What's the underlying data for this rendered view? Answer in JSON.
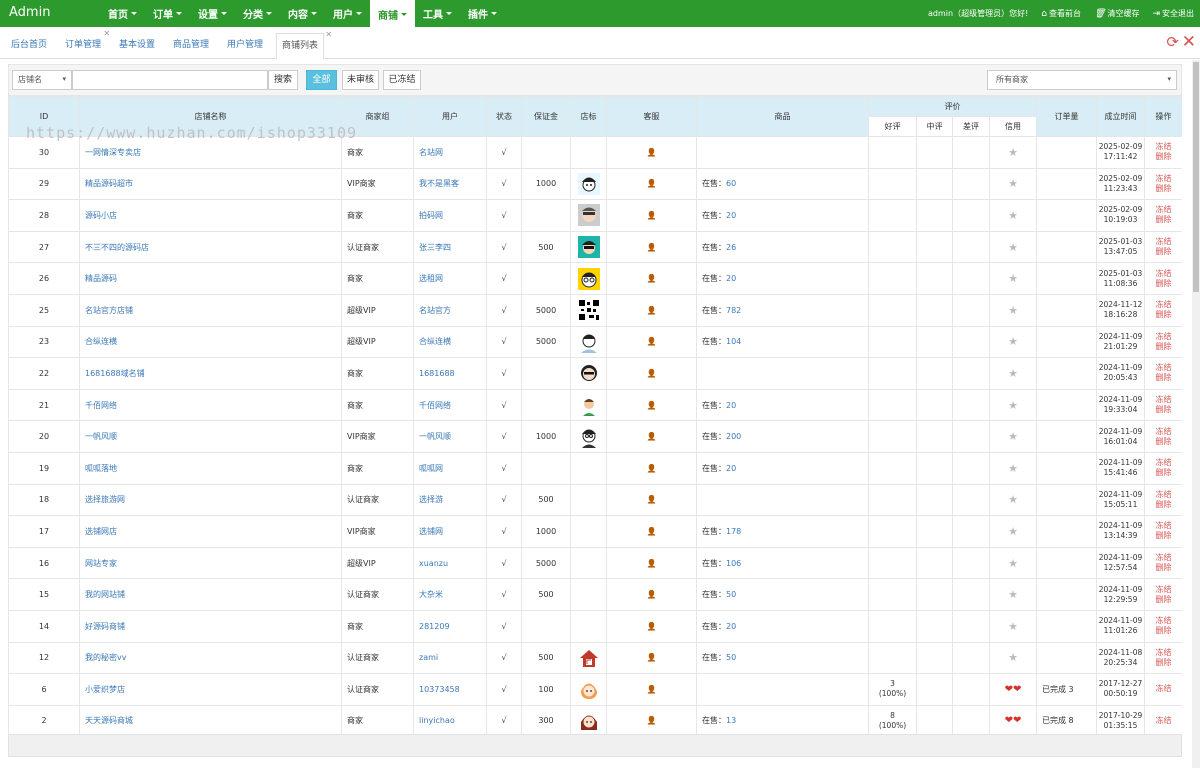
{
  "topbar": {
    "brand": "Admin",
    "nav": [
      {
        "label": "首页"
      },
      {
        "label": "订单"
      },
      {
        "label": "设置"
      },
      {
        "label": "分类"
      },
      {
        "label": "内容"
      },
      {
        "label": "用户"
      },
      {
        "label": "商铺",
        "active": true
      },
      {
        "label": "工具"
      },
      {
        "label": "插件"
      }
    ],
    "user": "admin（超级管理员）您好!",
    "view_front": "查看前台",
    "clear_cache": "清空缓存",
    "logout": "安全退出"
  },
  "tabs": [
    {
      "label": "后台首页",
      "closable": false
    },
    {
      "label": "订单管理",
      "closable": true
    },
    {
      "label": "基本设置",
      "closable": false
    },
    {
      "label": "商品管理",
      "closable": false
    },
    {
      "label": "用户管理",
      "closable": false
    },
    {
      "label": "商铺列表",
      "closable": true,
      "active": true
    }
  ],
  "toolbar": {
    "field_select": "店铺名",
    "search_placeholder": "",
    "search_button": "搜索",
    "filters": {
      "all": "全部",
      "unreviewed": "未审核",
      "frozen": "已冻结"
    },
    "merchant_select": "所有商家"
  },
  "table": {
    "headers": {
      "id": "ID",
      "name": "店铺名称",
      "group": "商家组",
      "user": "用户",
      "status": "状态",
      "deposit": "保证金",
      "logo": "店标",
      "service": "客服",
      "goods": "商品",
      "review": "评价",
      "good": "好评",
      "mid": "中评",
      "bad": "差评",
      "credit": "信用",
      "orders": "订单量",
      "created": "成立时间",
      "ops": "操作"
    },
    "rows": [
      {
        "id": "30",
        "name": "一网情深专卖店",
        "group": "商家",
        "user": "名站网",
        "status": "√",
        "deposit": "",
        "avatar": null,
        "goods_prefix": "",
        "goods_count": "",
        "good_review": "",
        "good_pct": "",
        "credit": "star",
        "orders": "",
        "date": "2025-02-09",
        "time": "17:11:42",
        "ops": [
          "冻结",
          "删除"
        ]
      },
      {
        "id": "29",
        "name": "精品源码超市",
        "group": "VIP商家",
        "user": "我不是黑客",
        "status": "√",
        "deposit": "1000",
        "avatar": "a1",
        "goods_prefix": "在售：",
        "goods_count": "60",
        "good_review": "",
        "good_pct": "",
        "credit": "star",
        "orders": "",
        "date": "2025-02-09",
        "time": "11:23:43",
        "ops": [
          "冻结",
          "删除"
        ]
      },
      {
        "id": "28",
        "name": "源码小店",
        "group": "商家",
        "user": "拍码网",
        "status": "√",
        "deposit": "",
        "avatar": "a2",
        "goods_prefix": "在售：",
        "goods_count": "20",
        "good_review": "",
        "good_pct": "",
        "credit": "star",
        "orders": "",
        "date": "2025-02-09",
        "time": "10:19:03",
        "ops": [
          "冻结",
          "删除"
        ]
      },
      {
        "id": "27",
        "name": "不三不四的源码店",
        "group": "认证商家",
        "user": "张三李四",
        "status": "√",
        "deposit": "500",
        "avatar": "a3",
        "goods_prefix": "在售：",
        "goods_count": "26",
        "good_review": "",
        "good_pct": "",
        "credit": "star",
        "orders": "",
        "date": "2025-01-03",
        "time": "13:47:05",
        "ops": [
          "冻结",
          "删除"
        ]
      },
      {
        "id": "26",
        "name": "精品源码",
        "group": "商家",
        "user": "选租网",
        "status": "√",
        "deposit": "",
        "avatar": "a4",
        "goods_prefix": "在售：",
        "goods_count": "20",
        "good_review": "",
        "good_pct": "",
        "credit": "star",
        "orders": "",
        "date": "2025-01-03",
        "time": "11:08:36",
        "ops": [
          "冻结",
          "删除"
        ]
      },
      {
        "id": "25",
        "name": "名站官方店铺",
        "group": "超级VIP",
        "user": "名站官方",
        "status": "√",
        "deposit": "5000",
        "avatar": "qr",
        "goods_prefix": "在售：",
        "goods_count": "782",
        "good_review": "",
        "good_pct": "",
        "credit": "star",
        "orders": "",
        "date": "2024-11-12",
        "time": "18:16:28",
        "ops": [
          "冻结",
          "删除"
        ]
      },
      {
        "id": "23",
        "name": "合纵连横",
        "group": "超级VIP",
        "user": "合纵连横",
        "status": "√",
        "deposit": "5000",
        "avatar": "a5",
        "goods_prefix": "在售：",
        "goods_count": "104",
        "good_review": "",
        "good_pct": "",
        "credit": "star",
        "orders": "",
        "date": "2024-11-09",
        "time": "21:01:29",
        "ops": [
          "冻结",
          "删除"
        ]
      },
      {
        "id": "22",
        "name": "1681688域名铺",
        "group": "商家",
        "user": "1681688",
        "status": "√",
        "deposit": "",
        "avatar": "a6",
        "goods_prefix": "",
        "goods_count": "",
        "good_review": "",
        "good_pct": "",
        "credit": "star",
        "orders": "",
        "date": "2024-11-09",
        "time": "20:05:43",
        "ops": [
          "冻结",
          "删除"
        ]
      },
      {
        "id": "21",
        "name": "千佰网络",
        "group": "商家",
        "user": "千佰网络",
        "status": "√",
        "deposit": "",
        "avatar": "a7",
        "goods_prefix": "在售：",
        "goods_count": "20",
        "good_review": "",
        "good_pct": "",
        "credit": "star",
        "orders": "",
        "date": "2024-11-09",
        "time": "19:33:04",
        "ops": [
          "冻结",
          "删除"
        ]
      },
      {
        "id": "20",
        "name": "一帆风顺",
        "group": "VIP商家",
        "user": "一帆风顺",
        "status": "√",
        "deposit": "1000",
        "avatar": "a8",
        "goods_prefix": "在售：",
        "goods_count": "200",
        "good_review": "",
        "good_pct": "",
        "credit": "star",
        "orders": "",
        "date": "2024-11-09",
        "time": "16:01:04",
        "ops": [
          "冻结",
          "删除"
        ]
      },
      {
        "id": "19",
        "name": "呱呱落地",
        "group": "商家",
        "user": "呱呱网",
        "status": "√",
        "deposit": "",
        "avatar": null,
        "goods_prefix": "在售：",
        "goods_count": "20",
        "good_review": "",
        "good_pct": "",
        "credit": "star",
        "orders": "",
        "date": "2024-11-09",
        "time": "15:41:46",
        "ops": [
          "冻结",
          "删除"
        ]
      },
      {
        "id": "18",
        "name": "选择旅游网",
        "group": "认证商家",
        "user": "选择游",
        "status": "√",
        "deposit": "500",
        "avatar": null,
        "goods_prefix": "",
        "goods_count": "",
        "good_review": "",
        "good_pct": "",
        "credit": "star",
        "orders": "",
        "date": "2024-11-09",
        "time": "15:05:11",
        "ops": [
          "冻结",
          "删除"
        ]
      },
      {
        "id": "17",
        "name": "选铺网店",
        "group": "VIP商家",
        "user": "选铺网",
        "status": "√",
        "deposit": "1000",
        "avatar": null,
        "goods_prefix": "在售：",
        "goods_count": "178",
        "good_review": "",
        "good_pct": "",
        "credit": "star",
        "orders": "",
        "date": "2024-11-09",
        "time": "13:14:39",
        "ops": [
          "冻结",
          "删除"
        ]
      },
      {
        "id": "16",
        "name": "网站专家",
        "group": "超级VIP",
        "user": "xuanzu",
        "status": "√",
        "deposit": "5000",
        "avatar": null,
        "goods_prefix": "在售：",
        "goods_count": "106",
        "good_review": "",
        "good_pct": "",
        "credit": "star",
        "orders": "",
        "date": "2024-11-09",
        "time": "12:57:54",
        "ops": [
          "冻结",
          "删除"
        ]
      },
      {
        "id": "15",
        "name": "我的网站铺",
        "group": "认证商家",
        "user": "大杂米",
        "status": "√",
        "deposit": "500",
        "avatar": null,
        "goods_prefix": "在售：",
        "goods_count": "50",
        "good_review": "",
        "good_pct": "",
        "credit": "star",
        "orders": "",
        "date": "2024-11-09",
        "time": "12:29:59",
        "ops": [
          "冻结",
          "删除"
        ]
      },
      {
        "id": "14",
        "name": "好源码商铺",
        "group": "商家",
        "user": "281209",
        "status": "√",
        "deposit": "",
        "avatar": null,
        "goods_prefix": "在售：",
        "goods_count": "20",
        "good_review": "",
        "good_pct": "",
        "credit": "star",
        "orders": "",
        "date": "2024-11-09",
        "time": "11:01:26",
        "ops": [
          "冻结",
          "删除"
        ]
      },
      {
        "id": "12",
        "name": "我的秘密vv",
        "group": "认证商家",
        "user": "zami",
        "status": "√",
        "deposit": "500",
        "avatar": "house",
        "goods_prefix": "在售：",
        "goods_count": "50",
        "good_review": "",
        "good_pct": "",
        "credit": "star",
        "orders": "",
        "date": "2024-11-08",
        "time": "20:25:34",
        "ops": [
          "冻结",
          "删除"
        ]
      },
      {
        "id": "6",
        "name": "小爱织梦店",
        "group": "认证商家",
        "user": "10373458",
        "status": "√",
        "deposit": "100",
        "avatar": "girl1",
        "goods_prefix": "",
        "goods_count": "",
        "good_review": "3",
        "good_pct": "(100%)",
        "credit": "hearts",
        "orders": "已完成 3",
        "date": "2017-12-27",
        "time": "00:50:19",
        "ops": [
          "冻结"
        ]
      },
      {
        "id": "2",
        "name": "天天源码商城",
        "group": "商家",
        "user": "linyichao",
        "status": "√",
        "deposit": "300",
        "avatar": "girl2",
        "goods_prefix": "在售：",
        "goods_count": "13",
        "good_review": "8",
        "good_pct": "(100%)",
        "credit": "hearts",
        "orders": "已完成 8",
        "date": "2017-10-29",
        "time": "01:35:15",
        "ops": [
          "冻结"
        ]
      }
    ]
  },
  "watermark": "https://www.huzhan.com/ishop33109",
  "colors": {
    "topbar": "#2c9a2d",
    "header": "#d9edf7",
    "link": "#3a78b8",
    "danger": "#d9534f",
    "info": "#5bc0de"
  }
}
